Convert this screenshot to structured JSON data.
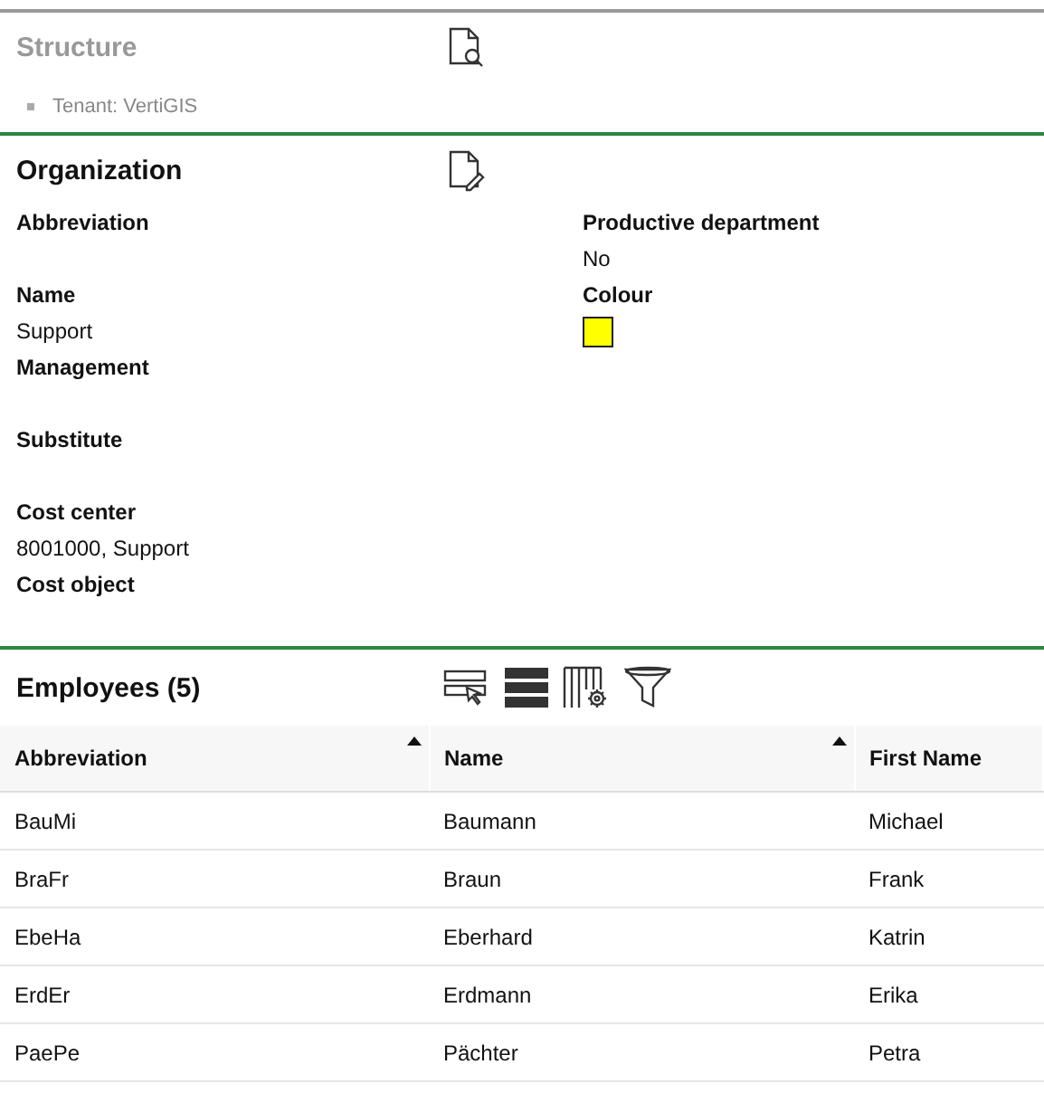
{
  "structure": {
    "title": "Structure",
    "items": [
      {
        "label": "Tenant: VertiGIS"
      }
    ]
  },
  "organization": {
    "title": "Organization",
    "left_fields": [
      {
        "label": "Abbreviation"
      },
      {
        "label": "Name",
        "value": "Support"
      },
      {
        "label": "Management"
      },
      {
        "label": "Substitute"
      },
      {
        "label": "Cost center",
        "value": "8001000, Support"
      },
      {
        "label": "Cost object"
      }
    ],
    "right_fields": [
      {
        "label": "Productive department",
        "kind": "text",
        "value": "No"
      },
      {
        "label": "Colour",
        "kind": "color",
        "color": "#ffff00"
      }
    ]
  },
  "employees": {
    "title": "Employees (5)",
    "columns": [
      {
        "label": "Abbreviation",
        "sorted": true
      },
      {
        "label": "Name",
        "sorted": true
      },
      {
        "label": "First Name",
        "sorted": false
      }
    ],
    "rows": [
      [
        "BauMi",
        "Baumann",
        "Michael"
      ],
      [
        "BraFr",
        "Braun",
        "Frank"
      ],
      [
        "EbeHa",
        "Eberhard",
        "Katrin"
      ],
      [
        "ErdEr",
        "Erdmann",
        "Erika"
      ],
      [
        "PaePe",
        "Pächter",
        "Petra"
      ]
    ]
  }
}
